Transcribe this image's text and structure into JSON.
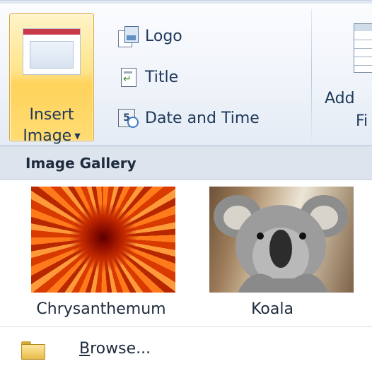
{
  "ribbon": {
    "insert_image": {
      "line1": "Insert",
      "line2": "Image"
    },
    "commands": {
      "logo": "Logo",
      "title": "Title",
      "date_time": "Date and Time"
    },
    "add_field": {
      "line1": "Add",
      "line2": "Fi"
    }
  },
  "gallery": {
    "header": "Image Gallery",
    "items": [
      {
        "label": "Chrysanthemum"
      },
      {
        "label": "Koala"
      }
    ]
  },
  "browse": {
    "access_key": "B",
    "rest": "rowse..."
  },
  "icons": {
    "insert_image": "picture-icon",
    "logo": "logo-icon",
    "title": "title-icon",
    "date_time": "date-time-icon",
    "browse": "folder-icon"
  },
  "colors": {
    "selected_button": "#ffd35c",
    "gallery_header_bg": "#dde4ee",
    "ribbon_text": "#1e395b"
  }
}
